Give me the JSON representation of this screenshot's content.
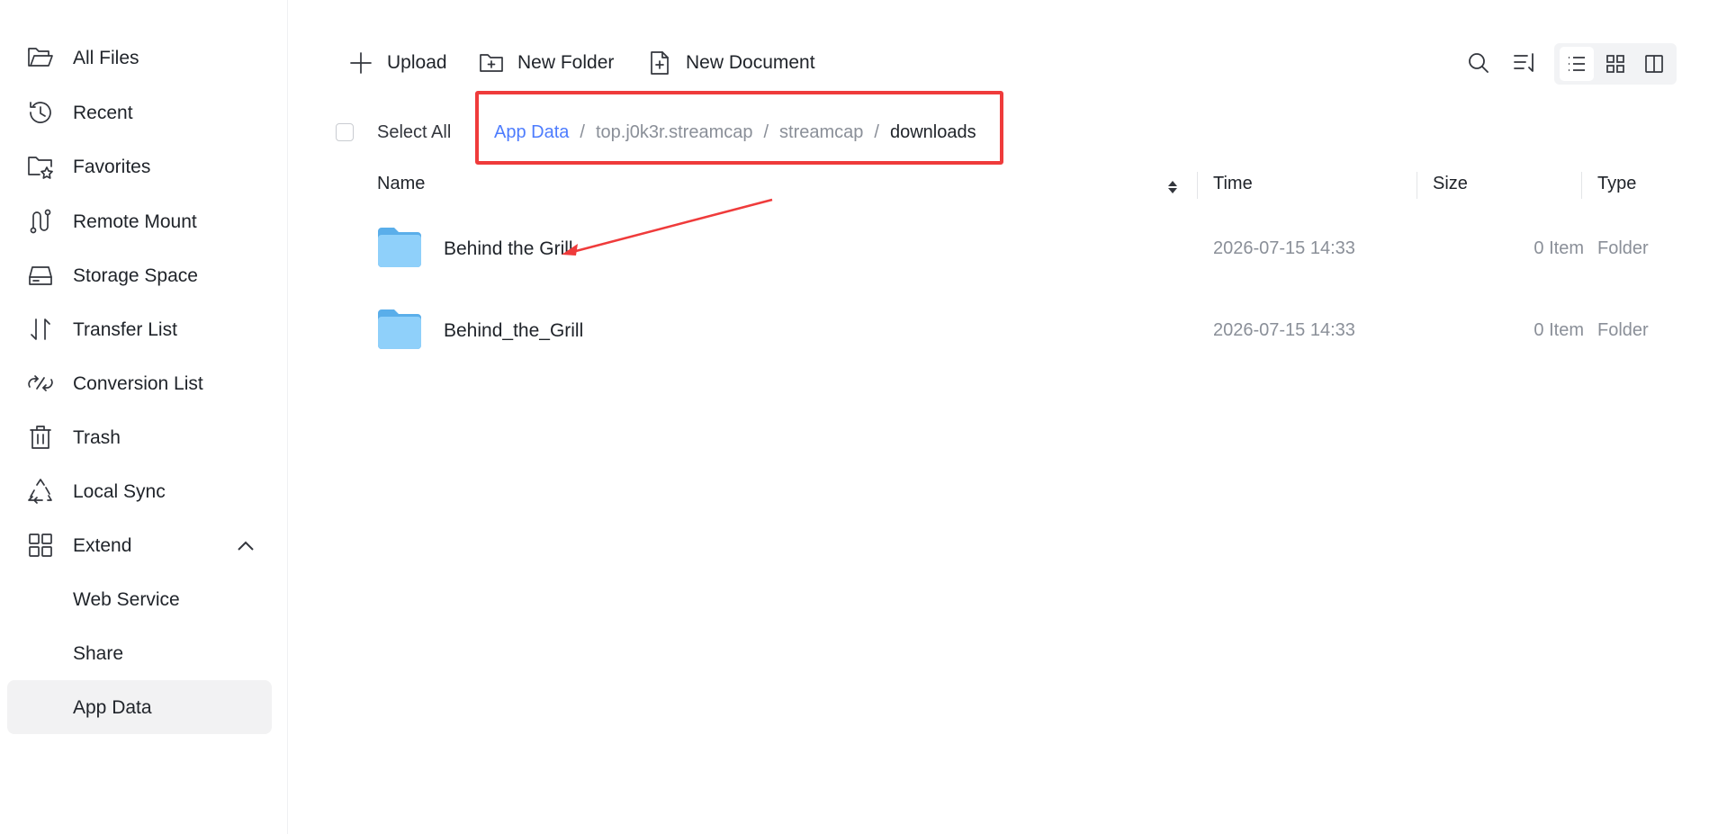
{
  "sidebar": {
    "items": [
      {
        "label": "All Files",
        "icon": "folder-open-icon"
      },
      {
        "label": "Recent",
        "icon": "history-icon"
      },
      {
        "label": "Favorites",
        "icon": "folder-star-icon"
      },
      {
        "label": "Remote Mount",
        "icon": "route-icon"
      },
      {
        "label": "Storage Space",
        "icon": "hard-drive-icon"
      },
      {
        "label": "Transfer List",
        "icon": "transfer-arrows-icon"
      },
      {
        "label": "Conversion List",
        "icon": "convert-icon"
      },
      {
        "label": "Trash",
        "icon": "trash-icon"
      },
      {
        "label": "Local Sync",
        "icon": "recycle-sync-icon"
      },
      {
        "label": "Extend",
        "icon": "grid-icon",
        "expanded": true
      },
      {
        "label": "Web Service"
      },
      {
        "label": "Share"
      },
      {
        "label": "App Data",
        "active": true
      }
    ]
  },
  "toolbar": {
    "upload_label": "Upload",
    "new_folder_label": "New Folder",
    "new_document_label": "New Document",
    "active_view": "list"
  },
  "breadcrumb_row": {
    "select_all_label": "Select All",
    "path": [
      "App Data",
      "top.j0k3r.streamcap",
      "streamcap",
      "downloads"
    ],
    "separator": "/"
  },
  "table": {
    "columns": [
      "Name",
      "Time",
      "Size",
      "Type"
    ],
    "rows": [
      {
        "name": "Behind the Grill",
        "time": "2026-07-15 14:33",
        "size": "0 Item",
        "type": "Folder"
      },
      {
        "name": "Behind_the_Grill",
        "time": "2026-07-15 14:33",
        "size": "0 Item",
        "type": "Folder"
      }
    ]
  },
  "colors": {
    "accent": "#4d7cfe",
    "annotation": "#ef3b3b",
    "active_bg": "#f2f2f3"
  }
}
